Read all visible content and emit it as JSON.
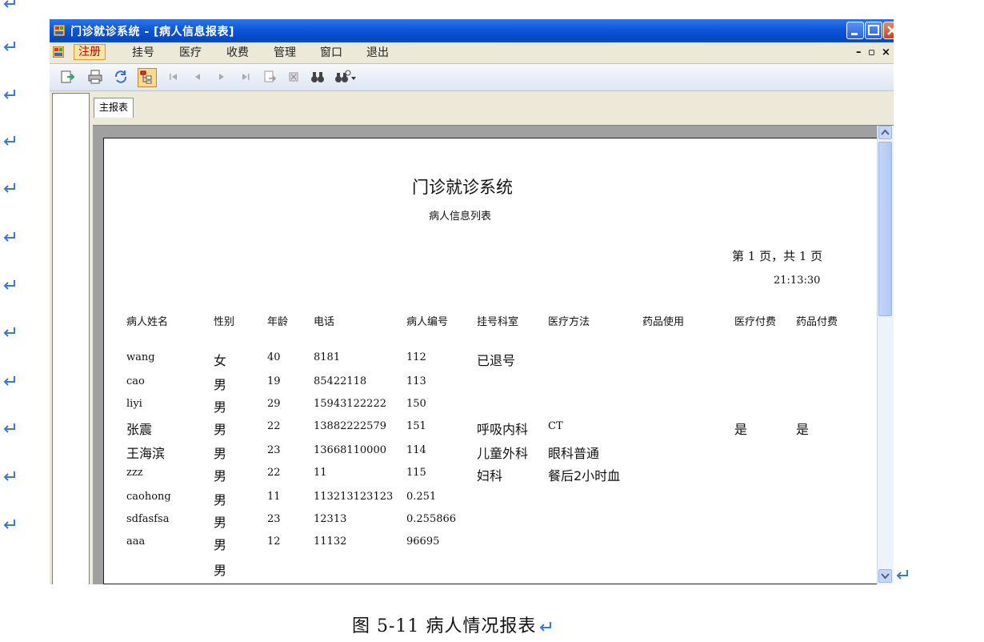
{
  "window": {
    "title": "门诊就诊系统 - [病人信息报表]"
  },
  "menu": {
    "items": [
      "注册",
      "挂号",
      "医疗",
      "收费",
      "管理",
      "窗口",
      "退出"
    ]
  },
  "report_tab": "主报表",
  "report": {
    "title": "门诊就诊系统",
    "subtitle": "病人信息列表",
    "page_info": "第 1 页，共 1 页",
    "time": "21:13:30",
    "columns": [
      "病人姓名",
      "性别",
      "年龄",
      "电话",
      "病人编号",
      "挂号科室",
      "医疗方法",
      "药品使用",
      "医疗付费",
      "药品付费"
    ],
    "rows": [
      [
        "wang",
        "女",
        "40",
        "8181",
        "112",
        "已退号",
        "",
        "",
        "",
        ""
      ],
      [
        "cao",
        "男",
        "19",
        "85422118",
        "113",
        "",
        "",
        "",
        "",
        ""
      ],
      [
        "liyi",
        "男",
        "29",
        "15943122222",
        "150",
        "",
        "",
        "",
        "",
        ""
      ],
      [
        "张震",
        "男",
        "22",
        "13882222579",
        "151",
        "呼吸内科",
        "CT",
        "",
        "是",
        "是"
      ],
      [
        "王海滨",
        "男",
        "23",
        "13668110000",
        "114",
        "儿童外科",
        "眼科普通",
        "",
        "",
        ""
      ],
      [
        "zzz",
        "男",
        "22",
        "11",
        "115",
        "妇科",
        "餐后2小时血",
        "",
        "",
        ""
      ],
      [
        "caohong",
        "男",
        "11",
        "113213123123",
        "0.251",
        "",
        "",
        "",
        "",
        ""
      ],
      [
        "sdfasfsa",
        "男",
        "23",
        "12313",
        "0.255866",
        "",
        "",
        "",
        "",
        ""
      ],
      [
        "aaa",
        "男",
        "12",
        "11132",
        "96695",
        "",
        "",
        "",
        "",
        ""
      ],
      [
        "",
        "男",
        "",
        "",
        "",
        "",
        "",
        "",
        "",
        ""
      ]
    ]
  },
  "caption": "图 5-11 病人情况报表",
  "colors": {
    "titlebar": "#0a4bc9",
    "return_mark": "#3b78d0",
    "menu_active_bg": "#fbe3a3"
  }
}
